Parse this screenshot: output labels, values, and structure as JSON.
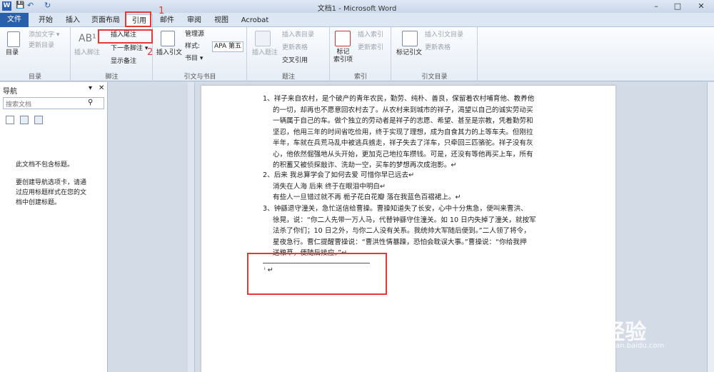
{
  "window": {
    "title": "文档1 - Microsoft Word",
    "min": "–",
    "max": "□",
    "close": "✕"
  },
  "quick_access": {
    "save": "💾",
    "undo": "↶",
    "redo": "↻"
  },
  "tabs": [
    "文件",
    "开始",
    "插入",
    "页面布局",
    "引用",
    "邮件",
    "审阅",
    "视图",
    "Acrobat"
  ],
  "ribbon": {
    "toc": {
      "label": "目录",
      "add_text": "添加文字 ▾",
      "update": "更新目录",
      "group": "目录"
    },
    "footnotes": {
      "insert_footnote": "插入脚注",
      "insert_endnote": "插入尾注",
      "next_footnote": "下一条脚注 ▾",
      "show_notes": "显示备注",
      "group": "脚注"
    },
    "citations": {
      "insert_citation": "插入引文",
      "manage_sources": "管理源",
      "style_label": "样式:",
      "style_value": "APA 第五",
      "bibliography": "书目 ▾",
      "group": "引文与书目"
    },
    "captions": {
      "insert_caption": "插入题注",
      "insert_table_of_figures": "插入表目录",
      "update_table": "更新表格",
      "cross_ref": "交叉引用",
      "group": "题注"
    },
    "index": {
      "mark_entry": "标记\n索引项",
      "insert_index": "插入索引",
      "update_index": "更新索引",
      "group": "索引"
    },
    "toa": {
      "mark_citation": "标记引文",
      "insert_toa": "插入引文目录",
      "update_table": "更新表格",
      "group": "引文目录"
    }
  },
  "nav": {
    "title": "导航",
    "search_placeholder": "搜索文档",
    "empty_title": "此文档不包含标题。",
    "empty_help": "要创建导航选项卡，请通过应用标题样式在您的文档中创建标题。"
  },
  "doc": {
    "p1": [
      "1、祥子来自农村，是个破产的青年农民，勤劳、纯朴、善良，保留着农村哺育他、教养他",
      "的一切，却再也不愿意回农村去了。从农村来到城市的祥子，渴望以自己的诚实劳动买",
      "一辆属于自己的车。做个独立的劳动者是祥子的志愿、希望、甚至是宗教，凭着勤劳和",
      "坚忍，他用三年的时间省吃俭用，终于实现了理想，成为自食其力的上等车夫。但刚拉",
      "半年，车就在兵荒马乱中被逃兵掳走，祥子失去了洋车，只牵回三匹骆驼。祥子没有灰",
      "心，他依然倔强地从头开始，更加克己地拉车攒钱。可是，还没有等他再买上车，所有",
      "的积蓄又被侦探敲诈、洗劫一空，买车的梦想再次成泡影。↵"
    ],
    "p2": [
      "2、后来    我总算学会了如何去爱      可惜你早已远去↵",
      "消失在人海      后来      终于在眼泪中明白↵",
      "有些人一旦错过就不再      栀子花白花瓣      落在我蓝色百褶裙上。↵"
    ],
    "p3": [
      "3、钟繇退守潼关，急忙送信给曹操。曹操知道失了长安，心中十分焦急，便叫来曹洪、",
      "徐晃，说：“你二人先带一万人马，代替钟繇守住潼关。如 10 日内失掉了潼关，就按军",
      "法杀了你们；10 日之外，与你二人没有关系。我统帅大军随后便到。”二人领了将令，",
      "星夜急行。曹仁提醒曹操说：“曹洪性情暴躁，恐怕会耽误大事。”曹操说：“你给我押",
      "送粮草，便随后接应。”↵"
    ],
    "endnote_mark": "ⁱ ↵"
  },
  "annotations": {
    "step1": "1",
    "step2": "2"
  },
  "watermark": {
    "brand": "Baidu经验",
    "url": "jingyan.baidu.com"
  }
}
